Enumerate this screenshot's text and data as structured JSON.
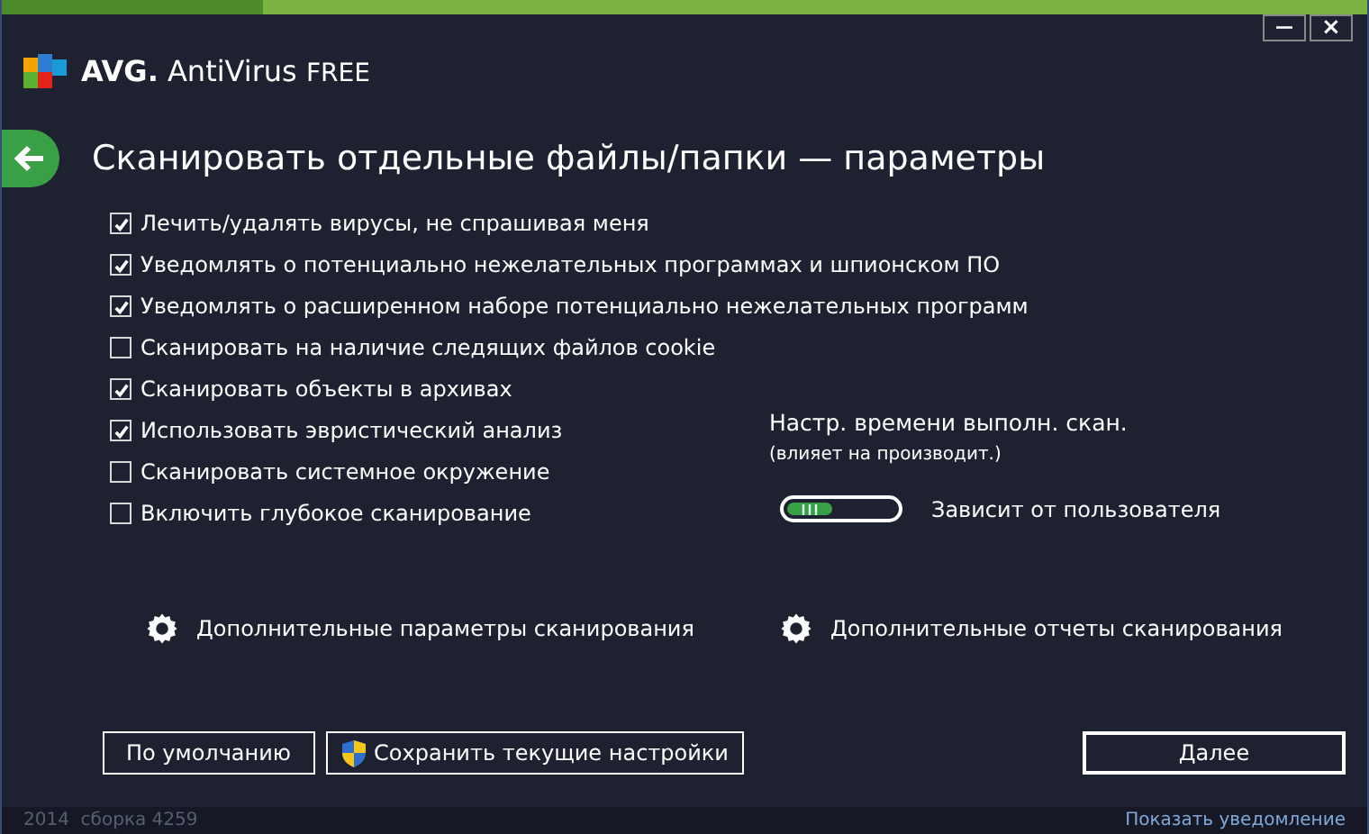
{
  "window": {
    "app_name": "AVG.",
    "app_product": "AntiVirus",
    "app_edition": "FREE",
    "minimize": "—",
    "close": "×"
  },
  "title": "Сканировать отдельные файлы/папки — параметры",
  "options": [
    {
      "label": "Лечить/удалять вирусы, не спрашивая меня",
      "checked": true
    },
    {
      "label": "Уведомлять о потенциально нежелательных программах и шпионском ПО",
      "checked": true
    },
    {
      "label": "Уведомлять о расширенном наборе потенциально нежелательных программ",
      "checked": true
    },
    {
      "label": "Сканировать на наличие следящих файлов cookie",
      "checked": false
    },
    {
      "label": "Сканировать объекты в архивах",
      "checked": true
    },
    {
      "label": "Использовать эвристический анализ",
      "checked": true
    },
    {
      "label": "Сканировать системное окружение",
      "checked": false
    },
    {
      "label": "Включить глубокое сканирование",
      "checked": false
    }
  ],
  "scan_time": {
    "title": "Настр. времени выполн. скан.",
    "subtitle": "(влияет на производит.)",
    "level": 0.42,
    "reading": "Зависит от пользователя"
  },
  "links": [
    "Дополнительные параметры сканирования",
    "Дополнительные отчеты сканирования"
  ],
  "buttons": {
    "default": "По умолчанию",
    "save": "Сохранить текущие настройки",
    "next": "Далее"
  },
  "status_bar": {
    "build": "2014  сборка 4259",
    "notification": "Показать уведомление"
  }
}
